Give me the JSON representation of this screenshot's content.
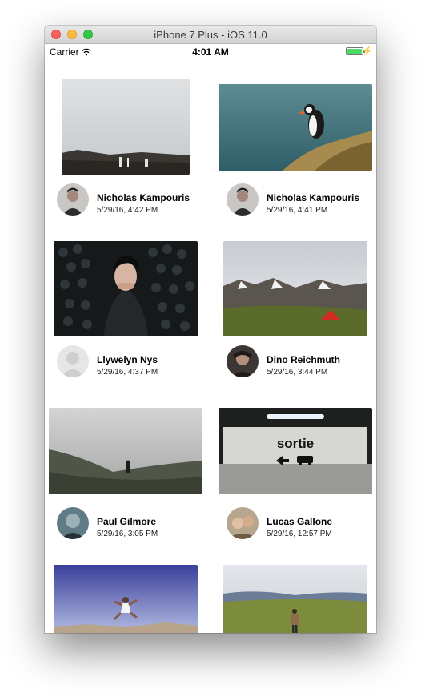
{
  "window": {
    "title": "iPhone 7 Plus - iOS 11.0"
  },
  "status": {
    "carrier": "Carrier",
    "time": "4:01 AM"
  },
  "cards": [
    {
      "name": "Nicholas Kampouris",
      "date": "5/29/16, 4:42 PM"
    },
    {
      "name": "Nicholas Kampouris",
      "date": "5/29/16, 4:41 PM"
    },
    {
      "name": "Llywelyn Nys",
      "date": "5/29/16, 4:37 PM"
    },
    {
      "name": "Dino Reichmuth",
      "date": "5/29/16, 3:44 PM"
    },
    {
      "name": "Paul Gilmore",
      "date": "5/29/16, 3:05 PM"
    },
    {
      "name": "Lucas Gallone",
      "date": "5/29/16, 12:57 PM"
    }
  ],
  "photo_sign_text": "sortie"
}
